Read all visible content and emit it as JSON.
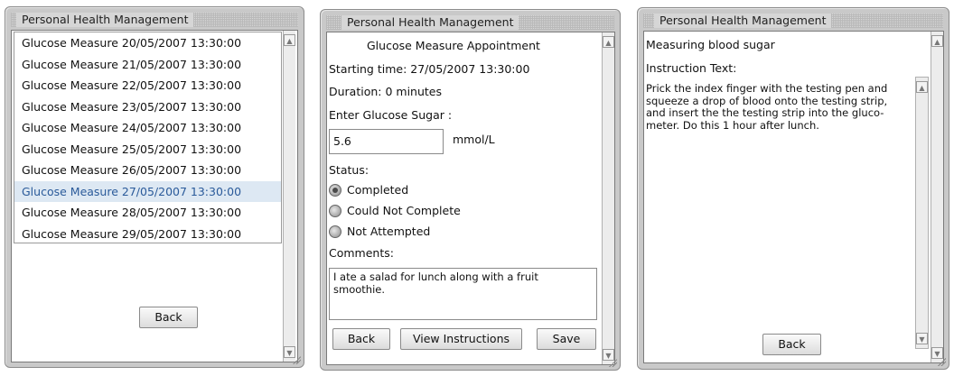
{
  "window1": {
    "title": "Personal Health Management",
    "items": [
      "Glucose Measure 20/05/2007 13:30:00",
      "Glucose Measure 21/05/2007 13:30:00",
      "Glucose Measure 22/05/2007 13:30:00",
      "Glucose Measure 23/05/2007 13:30:00",
      "Glucose Measure 24/05/2007 13:30:00",
      "Glucose Measure 25/05/2007 13:30:00",
      "Glucose Measure 26/05/2007 13:30:00",
      "Glucose Measure 27/05/2007 13:30:00",
      "Glucose Measure 28/05/2007 13:30:00",
      "Glucose Measure 29/05/2007 13:30:00"
    ],
    "selected_item": "Glucose Measure 27/05/2007 13:30:00",
    "back_label": "Back"
  },
  "window2": {
    "title": "Personal Health Management",
    "heading": "Glucose Measure  Appointment",
    "starting_time": "Starting time:  27/05/2007 13:30:00",
    "duration": "Duration:  0  minutes",
    "enter_label": "Enter  Glucose Sugar  :",
    "sugar_value": "5.6",
    "unit": "mmol/L",
    "status_label": "Status:",
    "status_options": [
      "Completed",
      "Could Not Complete",
      "Not Attempted"
    ],
    "status_selected": "Completed",
    "comments_label": "Comments:",
    "comments_text": "I ate a salad for lunch along with a fruit smoothie.",
    "back_label": "Back",
    "view_instructions_label": "View Instructions",
    "save_label": "Save"
  },
  "window3": {
    "title": "Personal Health Management",
    "heading": "Measuring blood sugar",
    "instruction_label": "Instruction Text:",
    "instruction_text": "Prick the index finger with the testing pen and squeeze a drop of blood onto the testing strip, and insert the the testing strip into the gluco-meter. Do this 1 hour after lunch.",
    "back_label": "Back"
  }
}
